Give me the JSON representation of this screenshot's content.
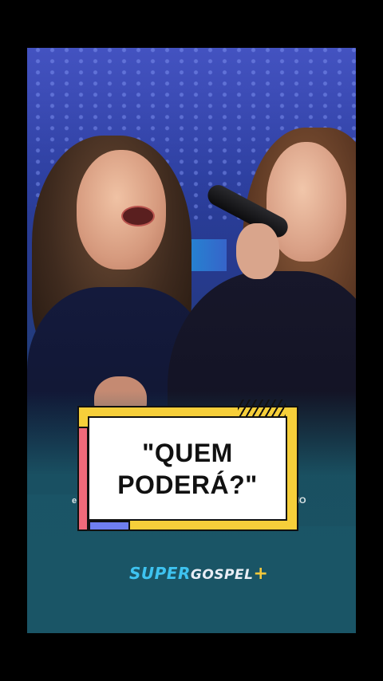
{
  "caption": {
    "line1": "\"QUEM",
    "line2": "PODERÁ?\""
  },
  "brand": {
    "super": "SUPER",
    "gospel": "GOSPEL",
    "plus": "+"
  },
  "side_text": {
    "left": "e",
    "right": "IO"
  },
  "colors": {
    "card_yellow": "#f6cf3a",
    "accent_pink": "#f06a7a",
    "accent_blue": "#6f7ef0",
    "brand_cyan": "#3ec3f0",
    "background": "#000000"
  }
}
